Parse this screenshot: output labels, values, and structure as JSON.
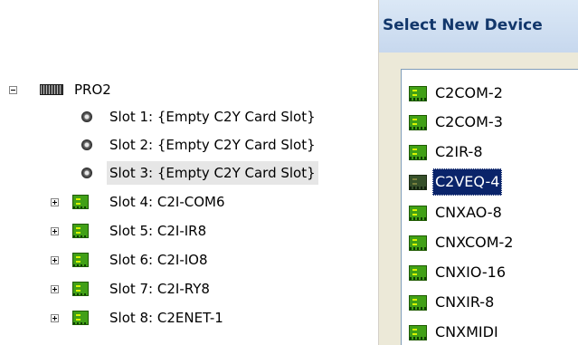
{
  "tree": {
    "root": {
      "label": "PRO2",
      "expander": "minus",
      "icon": "chassis-icon"
    },
    "slots": [
      {
        "label": "Slot 1: {Empty C2Y Card Slot}",
        "icon": "empty-slot-icon",
        "expandable": false,
        "selected": false
      },
      {
        "label": "Slot 2: {Empty C2Y Card Slot}",
        "icon": "empty-slot-icon",
        "expandable": false,
        "selected": false
      },
      {
        "label": "Slot 3: {Empty C2Y Card Slot}",
        "icon": "empty-slot-icon",
        "expandable": false,
        "selected": true
      },
      {
        "label": "Slot 4: C2I-COM6",
        "icon": "card-icon",
        "expandable": true,
        "selected": false
      },
      {
        "label": "Slot 5: C2I-IR8",
        "icon": "card-icon",
        "expandable": true,
        "selected": false
      },
      {
        "label": "Slot 6: C2I-IO8",
        "icon": "card-icon",
        "expandable": true,
        "selected": false
      },
      {
        "label": "Slot 7: C2I-RY8",
        "icon": "card-icon",
        "expandable": true,
        "selected": false
      },
      {
        "label": "Slot 8: C2ENET-1",
        "icon": "card-icon",
        "expandable": true,
        "selected": false
      }
    ]
  },
  "dialog": {
    "title": "Select New Device",
    "items": [
      {
        "label": "C2COM-2",
        "selected": false
      },
      {
        "label": "C2COM-3",
        "selected": false
      },
      {
        "label": "C2IR-8",
        "selected": false
      },
      {
        "label": "C2VEQ-4",
        "selected": true
      },
      {
        "label": "CNXAO-8",
        "selected": false
      },
      {
        "label": "CNXCOM-2",
        "selected": false
      },
      {
        "label": "CNXIO-16",
        "selected": false
      },
      {
        "label": "CNXIR-8",
        "selected": false
      },
      {
        "label": "CNXMIDI",
        "selected": false
      }
    ]
  },
  "colors": {
    "selection": "#0a246a",
    "card_green": "#41a017",
    "title_text": "#12376b"
  }
}
